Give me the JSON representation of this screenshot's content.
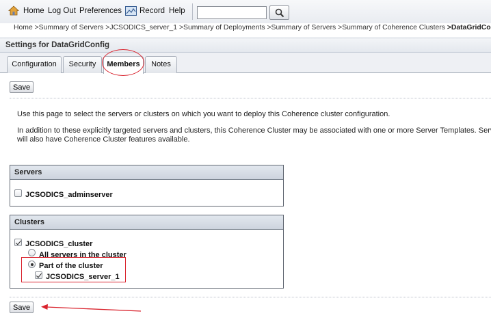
{
  "toolbar": {
    "home": "Home",
    "logout": "Log Out",
    "preferences": "Preferences",
    "record": "Record",
    "help": "Help",
    "search_value": "",
    "icons": {
      "home": "home-icon",
      "record": "record-icon",
      "search": "search-icon"
    }
  },
  "breadcrumb": {
    "items": [
      "Home",
      ">Summary of Servers",
      ">JCSODICS_server_1",
      ">Summary of Deployments",
      ">Summary of Servers",
      ">Summary of Coherence Clusters"
    ],
    "current": ">DataGridConfig"
  },
  "settings": {
    "title": "Settings for DataGridConfig"
  },
  "tabs": [
    {
      "label": "Configuration",
      "active": false
    },
    {
      "label": "Security",
      "active": false
    },
    {
      "label": "Members",
      "active": true
    },
    {
      "label": "Notes",
      "active": false
    }
  ],
  "buttons": {
    "save_top": "Save",
    "save_bottom": "Save"
  },
  "description": {
    "line1": "Use this page to select the servers or clusters on which you want to deploy this Coherence cluster configuration.",
    "line2": "In addition to these explicitly targeted servers and clusters, this Coherence Cluster may be associated with one or more Server Templates. Serv",
    "line3": "will also have Coherence Cluster features available."
  },
  "servers_panel": {
    "header": "Servers",
    "items": [
      {
        "label": "JCSODICS_adminserver",
        "checked": false
      }
    ]
  },
  "clusters_panel": {
    "header": "Clusters",
    "cluster": {
      "label": "JCSODICS_cluster",
      "checked": true
    },
    "options": [
      {
        "label": "All servers in the cluster",
        "selected": false
      },
      {
        "label": "Part of the cluster",
        "selected": true
      }
    ],
    "members": [
      {
        "label": "JCSODICS_server_1",
        "checked": true
      }
    ]
  },
  "annotation_color": "#d9232d"
}
